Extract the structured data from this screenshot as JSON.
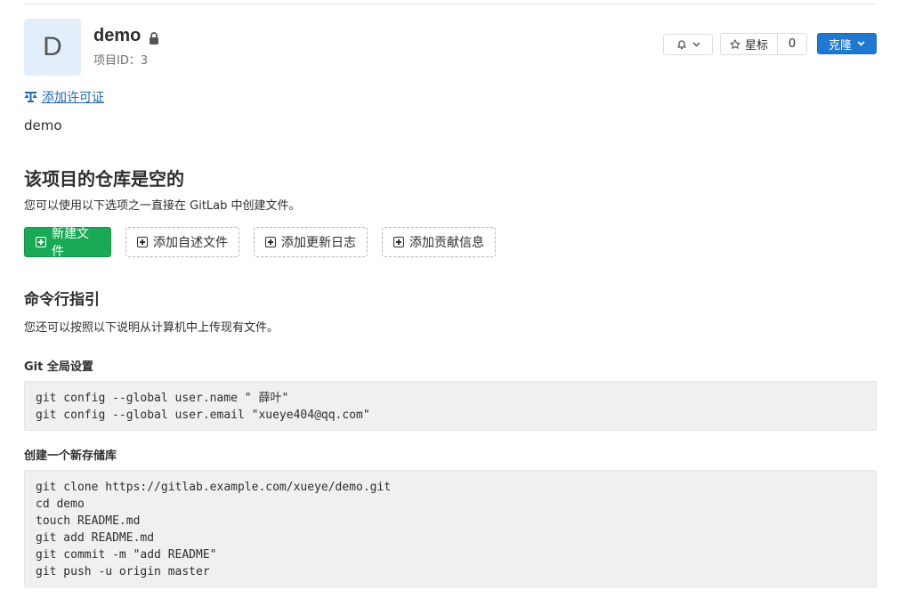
{
  "project": {
    "avatar_letter": "D",
    "name": "demo",
    "id_label": "项目ID：3",
    "license_link": "添加许可证",
    "description": "demo"
  },
  "header_actions": {
    "star_label": "星标",
    "star_count": "0",
    "clone_label": "克隆"
  },
  "empty_repo": {
    "title": "该项目的仓库是空的",
    "subtitle": "您可以使用以下选项之一直接在 GitLab 中创建文件。",
    "buttons": [
      "新建文件",
      "添加自述文件",
      "添加更新日志",
      "添加贡献信息"
    ]
  },
  "cli": {
    "title": "命令行指引",
    "subtitle": "您还可以按照以下说明从计算机中上传现有文件。",
    "global_title": "Git 全局设置",
    "global_lines": [
      "git config --global user.name \" 薛叶\"",
      "git config --global user.email \"xueye404@qq.com\""
    ],
    "new_repo_title": "创建一个新存储库",
    "new_repo_lines": [
      "git clone https://gitlab.example.com/xueye/demo.git",
      "cd demo",
      "touch README.md",
      "git add README.md",
      "git commit -m \"add README\"",
      "git push -u origin master"
    ]
  },
  "colors": {
    "primary": "#1f78d1",
    "success": "#1aaa55",
    "link": "#1b69b6"
  }
}
